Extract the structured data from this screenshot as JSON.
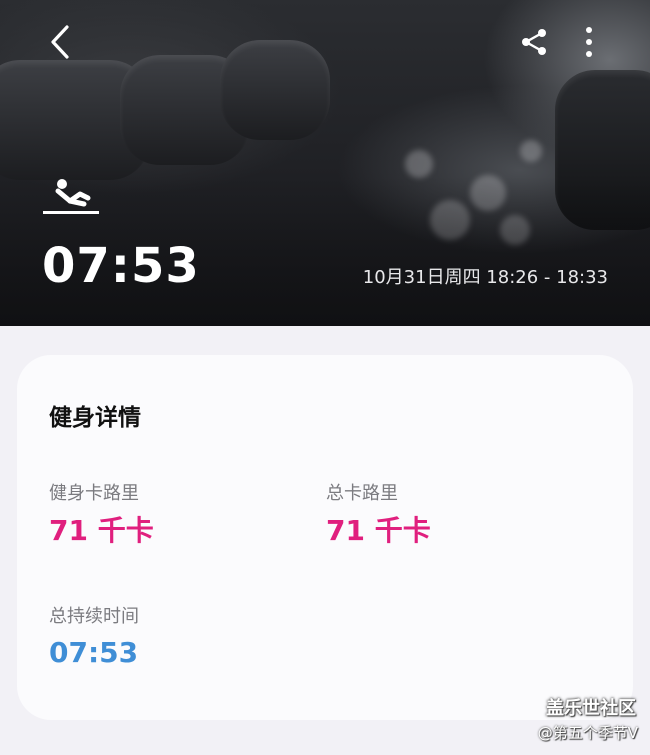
{
  "header": {
    "back_icon": "chevron-left-icon",
    "share_icon": "share-icon",
    "more_icon": "more-vertical-icon",
    "workout_icon": "sit-up-icon",
    "duration": "07:53",
    "datetime": "10月31日周四 18:26 - 18:33"
  },
  "details": {
    "title": "健身详情",
    "workout_calories_label": "健身卡路里",
    "workout_calories_value": "71 千卡",
    "total_calories_label": "总卡路里",
    "total_calories_value": "71 千卡",
    "total_duration_label": "总持续时间",
    "total_duration_value": "07:53"
  },
  "colors": {
    "calories": "#e01f7e",
    "duration": "#3f8ed6"
  },
  "watermark": {
    "site": "盖乐世社区",
    "author": "@第五个季节V"
  }
}
